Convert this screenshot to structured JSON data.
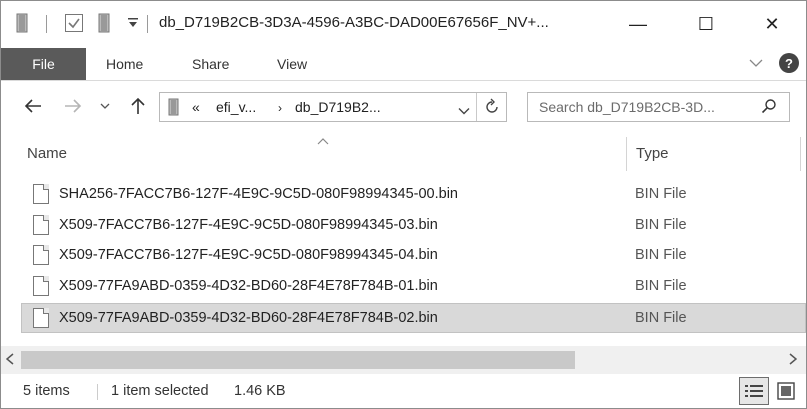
{
  "window": {
    "title": "db_D719B2CB-3D3A-4596-A3BC-DAD00E67656F_NV+...",
    "controls": {
      "minimize": "—",
      "maximize": "☐",
      "close": "✕"
    }
  },
  "ribbon": {
    "tabs": [
      {
        "label": "File"
      },
      {
        "label": "Home"
      },
      {
        "label": "Share"
      },
      {
        "label": "View"
      }
    ],
    "help": "?"
  },
  "address": {
    "overflow": "«",
    "segments": [
      "efi_v...",
      "db_D719B2..."
    ]
  },
  "search": {
    "placeholder": "Search db_D719B2CB-3D..."
  },
  "columns": {
    "name": "Name",
    "type": "Type"
  },
  "files": [
    {
      "name": "SHA256-7FACC7B6-127F-4E9C-9C5D-080F98994345-00.bin",
      "type": "BIN File",
      "selected": false
    },
    {
      "name": "X509-7FACC7B6-127F-4E9C-9C5D-080F98994345-03.bin",
      "type": "BIN File",
      "selected": false
    },
    {
      "name": "X509-7FACC7B6-127F-4E9C-9C5D-080F98994345-04.bin",
      "type": "BIN File",
      "selected": false
    },
    {
      "name": "X509-77FA9ABD-0359-4D32-BD60-28F4E78F784B-01.bin",
      "type": "BIN File",
      "selected": false
    },
    {
      "name": "X509-77FA9ABD-0359-4D32-BD60-28F4E78F784B-02.bin",
      "type": "BIN File",
      "selected": true
    }
  ],
  "status": {
    "item_count": "5 items",
    "selection": "1 item selected",
    "size": "1.46 KB"
  },
  "colors": {
    "file_tab_bg": "#5a5a5a",
    "selected_row_bg": "#d9d9d9"
  }
}
